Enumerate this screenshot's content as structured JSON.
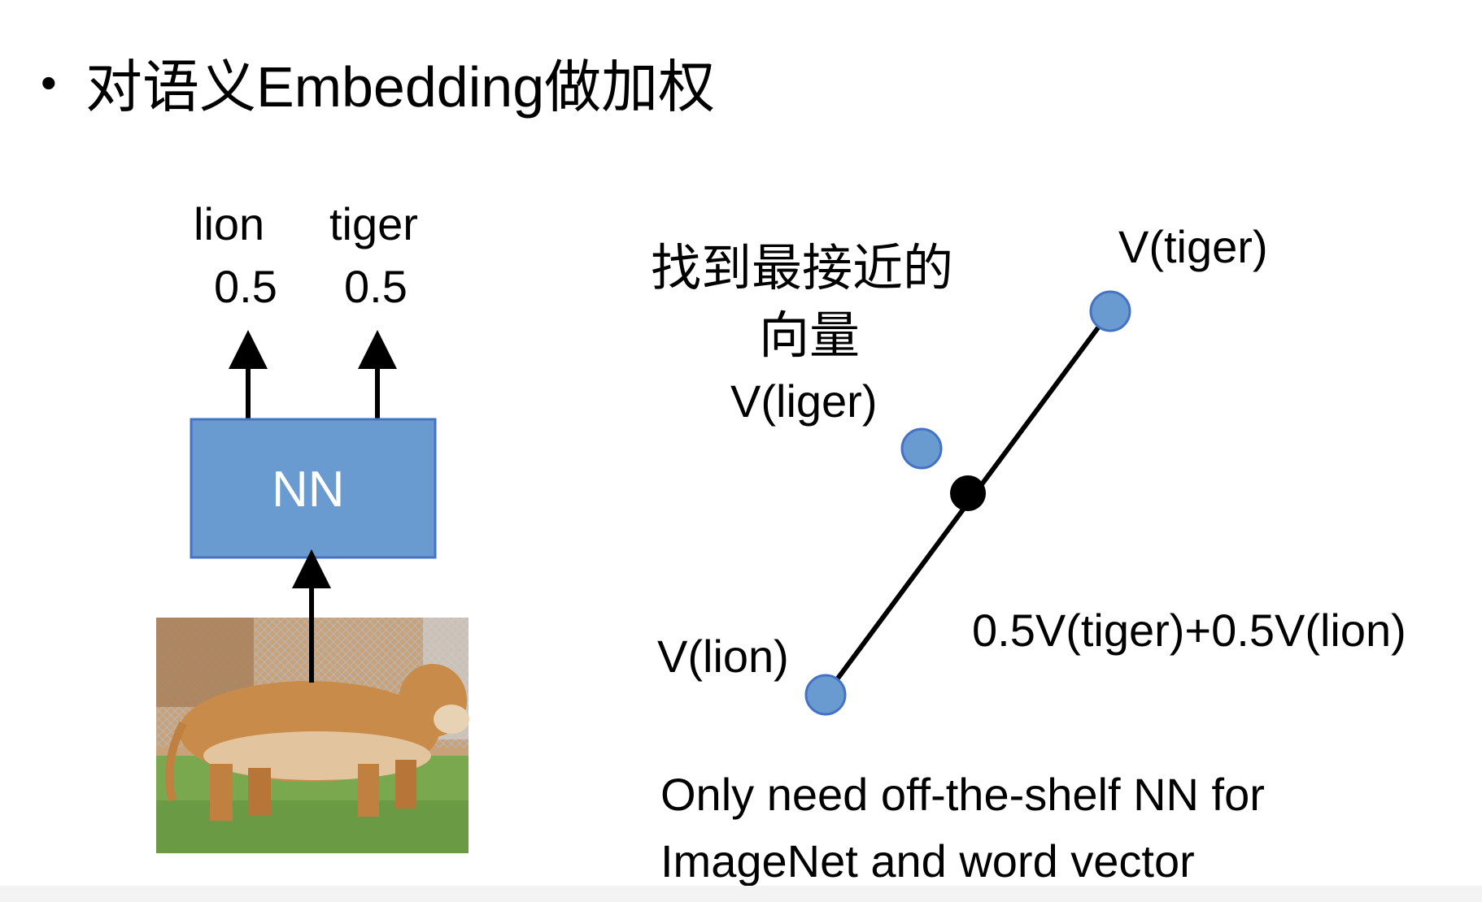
{
  "title": {
    "bullet": "•",
    "text": "对语义Embedding做加权"
  },
  "left_diagram": {
    "outputs": [
      {
        "label": "lion",
        "score": "0.5"
      },
      {
        "label": "tiger",
        "score": "0.5"
      }
    ],
    "network_label": "NN",
    "colors": {
      "box_fill": "#6a9bd0",
      "box_stroke": "#4472c4"
    }
  },
  "right_diagram": {
    "note_line1": "找到最接近的",
    "note_line2": "向量",
    "liger_label": "V(liger)",
    "tiger_label": "V(tiger)",
    "lion_label": "V(lion)",
    "combo_label": "0.5V(tiger)+0.5V(lion)",
    "colors": {
      "point": "#6a9bd0",
      "midpoint": "#000000"
    }
  },
  "caption": {
    "line1": "Only need off-the-shelf NN for",
    "line2": "ImageNet and word vector"
  }
}
